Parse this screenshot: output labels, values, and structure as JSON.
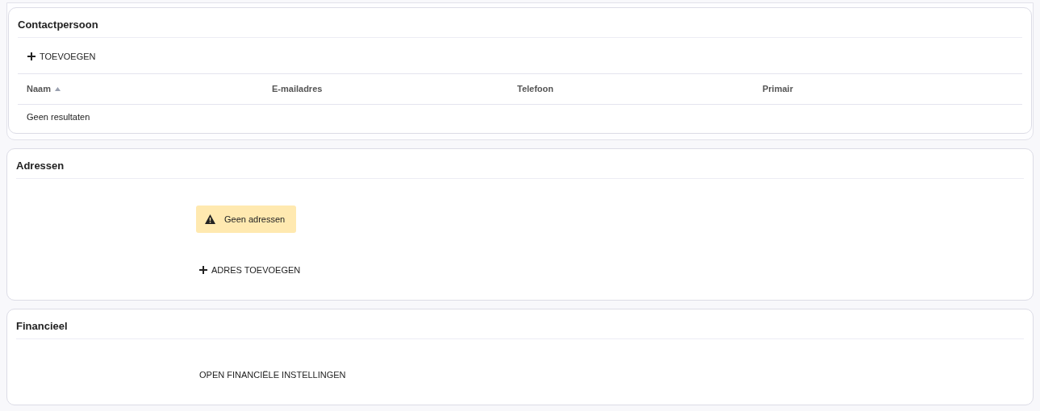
{
  "contact": {
    "title": "Contactpersoon",
    "add_button": "TOEVOEGEN",
    "columns": [
      {
        "label": "Naam",
        "sorted": true
      },
      {
        "label": "E-mailadres",
        "sorted": false
      },
      {
        "label": "Telefoon",
        "sorted": false
      },
      {
        "label": "Primair",
        "sorted": false
      }
    ],
    "empty_text": "Geen resultaten"
  },
  "addresses": {
    "title": "Adressen",
    "warning": "Geen adressen",
    "add_button": "ADRES TOEVOEGEN"
  },
  "financial": {
    "title": "Financieel",
    "open_button": "OPEN FINANCIËLE INSTELLINGEN"
  }
}
